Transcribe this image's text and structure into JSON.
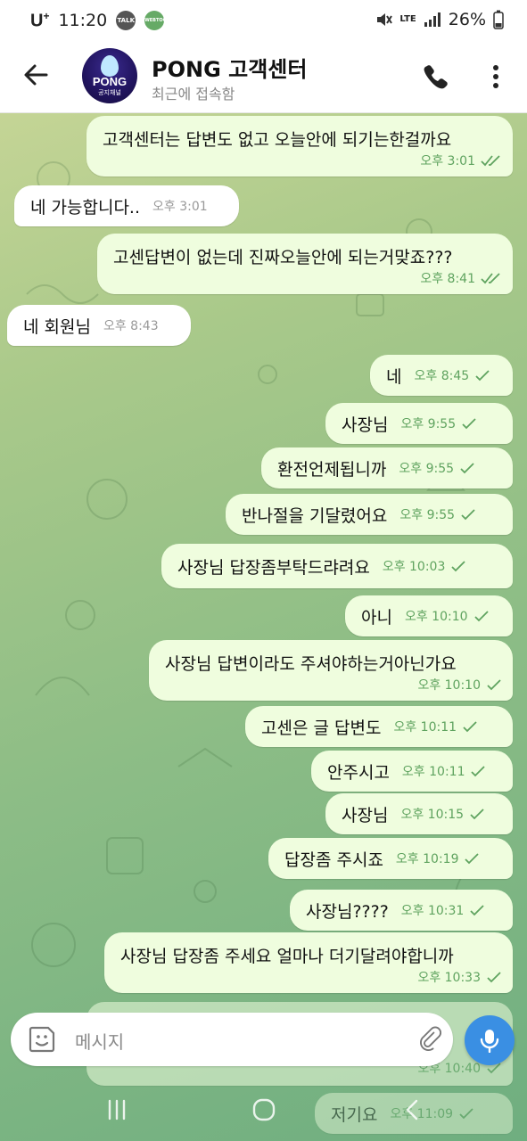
{
  "status_bar": {
    "carrier": "U",
    "carrier_sup": "+",
    "time": "11:20",
    "badge1": "TALK",
    "badge2": "WEBTOON",
    "signal": "LTE",
    "battery": "26%"
  },
  "header": {
    "title": "PONG 고객센터",
    "subtitle": "최근에 접속함",
    "avatar_text": "PONG",
    "avatar_sub": "공지채널"
  },
  "messages": [
    {
      "dir": "out",
      "text": "고객센터는 답변도 없고 오늘안에 되기는한걸까요",
      "time": "오후 3:01",
      "read": "double"
    },
    {
      "dir": "in",
      "text": "네 가능합니다..",
      "time": "오후 3:01"
    },
    {
      "dir": "out",
      "text": "고센답변이 없는데 진짜오늘안에 되는거맞죠???",
      "time": "오후 8:41",
      "read": "double"
    },
    {
      "dir": "in",
      "text": "네 회원님",
      "time": "오후 8:43"
    },
    {
      "dir": "out",
      "text": "네",
      "time": "오후 8:45",
      "read": "single"
    },
    {
      "dir": "out",
      "text": "사장님",
      "time": "오후 9:55",
      "read": "single"
    },
    {
      "dir": "out",
      "text": "환전언제됩니까",
      "time": "오후 9:55",
      "read": "single"
    },
    {
      "dir": "out",
      "text": "반나절을 기달렸어요",
      "time": "오후 9:55",
      "read": "single"
    },
    {
      "dir": "out",
      "text": "사장님 답장좀부탁드랴려요",
      "time": "오후 10:03",
      "read": "single"
    },
    {
      "dir": "out",
      "text": "아니",
      "time": "오후 10:10",
      "read": "single"
    },
    {
      "dir": "out",
      "text": "사장님 답변이라도 주셔야하는거아닌가요",
      "time": "오후 10:10",
      "read": "single"
    },
    {
      "dir": "out",
      "text": "고센은 글 답변도",
      "time": "오후 10:11",
      "read": "single"
    },
    {
      "dir": "out",
      "text": "안주시고",
      "time": "오후 10:11",
      "read": "single"
    },
    {
      "dir": "out",
      "text": "사장님",
      "time": "오후 10:15",
      "read": "single"
    },
    {
      "dir": "out",
      "text": "답장좀 주시죠",
      "time": "오후 10:19",
      "read": "single"
    },
    {
      "dir": "out",
      "text": "사장님????",
      "time": "오후 10:31",
      "read": "single"
    },
    {
      "dir": "out",
      "text": "사장님 답장좀 주세요 얼마나 더기달려야합니까",
      "time": "오후 10:33",
      "read": "single"
    },
    {
      "dir": "out",
      "text": "",
      "time": "오후 10:40",
      "read": "single"
    },
    {
      "dir": "out",
      "text": "저기요",
      "time": "오후 11:09",
      "read": "single"
    }
  ],
  "composer": {
    "placeholder": "메시지"
  },
  "colors": {
    "outgoing_bubble": "#effdde",
    "incoming_bubble": "#ffffff",
    "accent": "#3a8fe3",
    "check": "#5fa35f"
  }
}
